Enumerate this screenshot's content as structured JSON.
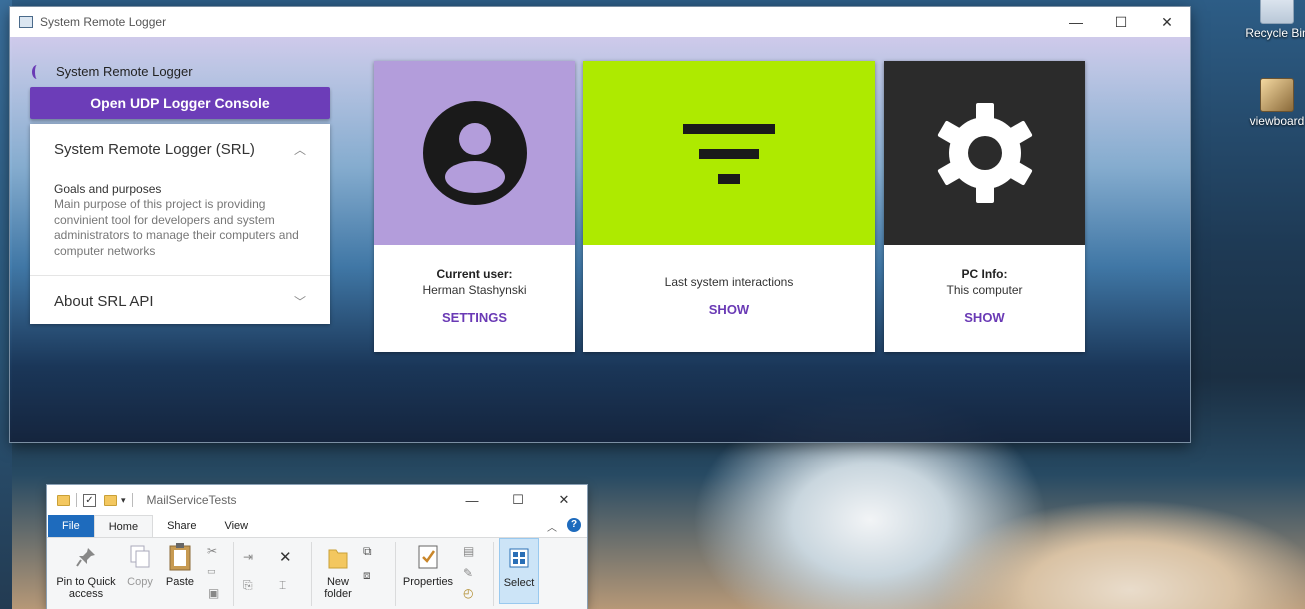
{
  "desktop": {
    "icons": [
      {
        "label": "Recycle Bin",
        "icon": "recycle-bin-icon"
      },
      {
        "label": "viewboard",
        "icon": "file-icon"
      }
    ]
  },
  "window": {
    "title": "System Remote Logger",
    "controls": {
      "minimize": "—",
      "maximize": "☐",
      "close": "✕"
    }
  },
  "sidebar": {
    "brand": "System Remote Logger",
    "udp_button": "Open UDP Logger Console",
    "accordion": [
      {
        "title": "System Remote Logger (SRL)",
        "expanded": true,
        "heading": "Goals and purposes",
        "body": "Main purpose of this project is providing convinient tool for developers and system administrators to manage their computers and computer networks"
      },
      {
        "title": "About SRL API",
        "expanded": false
      }
    ]
  },
  "cards": [
    {
      "color": "#b39ddb",
      "icon": "account-circle-icon",
      "line1": "Current user:",
      "line2": "Herman Stashynski",
      "action": "SETTINGS"
    },
    {
      "color": "#aeea00",
      "icon": "filter-list-icon",
      "line1": "Last system interactions",
      "action": "SHOW"
    },
    {
      "color": "#2b2b2b",
      "icon": "gear-icon",
      "line1": "PC Info:",
      "line2": "This computer",
      "action": "SHOW"
    }
  ],
  "explorer": {
    "title": "MailServiceTests",
    "tabs": [
      "File",
      "Home",
      "Share",
      "View"
    ],
    "ribbon": {
      "pin": "Pin to Quick access",
      "copy": "Copy",
      "paste": "Paste",
      "new_folder": "New folder",
      "properties": "Properties",
      "select": "Select"
    }
  }
}
